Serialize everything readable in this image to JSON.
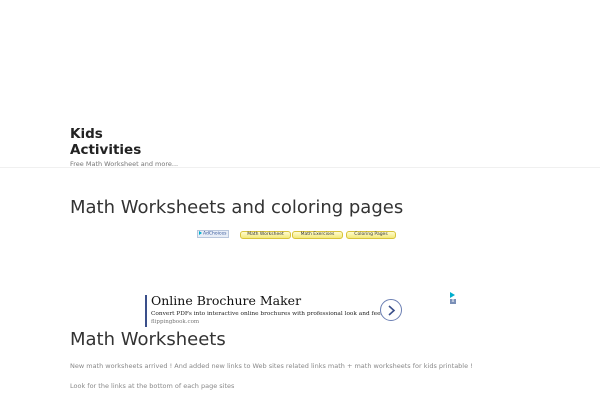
{
  "site": {
    "title": "Kids Activities",
    "tagline": "Free Math Worksheet and more..."
  },
  "page_title": "Math Worksheets and coloring pages",
  "ad_links": {
    "adchoices_label": "AdChoices",
    "links": [
      {
        "label": "Math Worksheet"
      },
      {
        "label": "Math Exercises"
      },
      {
        "label": "Coloring Pages"
      }
    ]
  },
  "banner_ad": {
    "title": "Online Brochure Maker",
    "description": "Convert PDFs into interactive online brochures with professional look and feel.",
    "display_url": "flippingbook.com",
    "close_label": "x"
  },
  "section": {
    "title": "Math Worksheets",
    "paragraphs": [
      "New math worksheets arrived ! And added new links to Web sites related links math + math worksheets for kids printable !",
      "Look for the links at the bottom of each page sites"
    ]
  },
  "colors": {
    "text": "#333333",
    "muted_text": "#888888",
    "ad_link_bg": "#f3e97a",
    "ad_accent": "#3a4f8a",
    "adchoices_triangle": "#00aecd"
  },
  "icons": {
    "banner_arrow": "chevron-right-icon",
    "adchoices": "adchoices-triangle-icon"
  }
}
